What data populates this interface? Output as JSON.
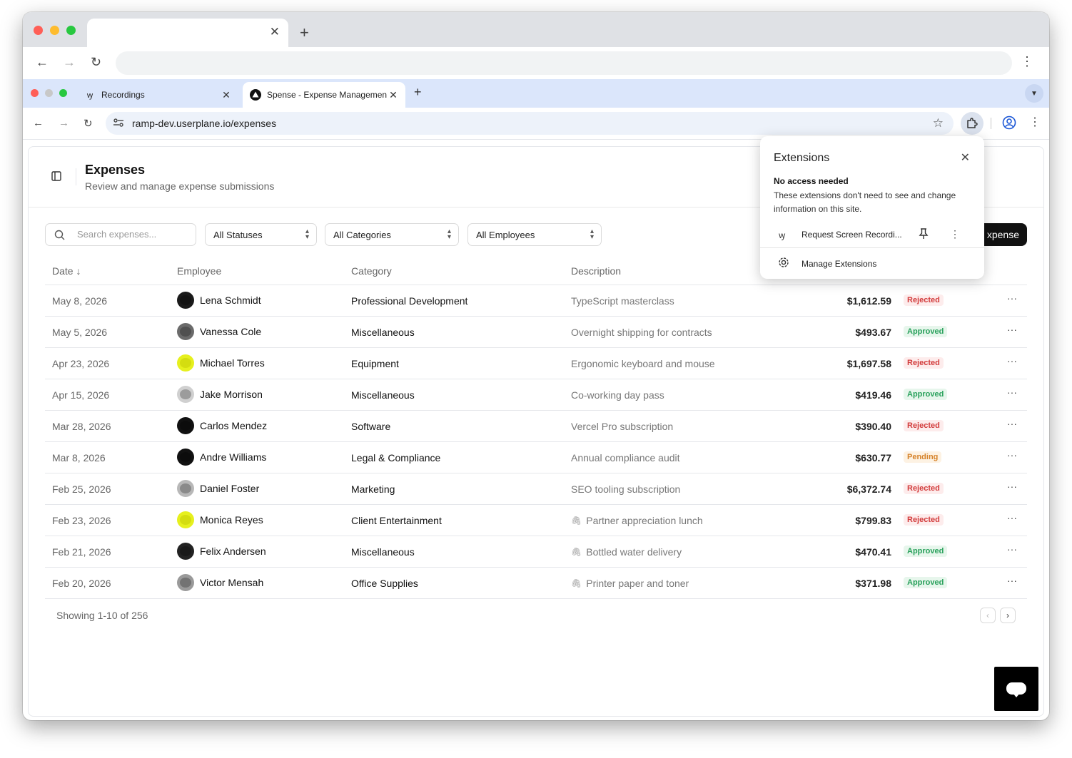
{
  "outer_browser": {
    "tab_close": "✕",
    "new_tab": "+",
    "back": "←",
    "forward": "→",
    "reload": "↻",
    "menu": "⋮"
  },
  "inner_browser": {
    "tabs": [
      {
        "title": "Recordings",
        "icon": "userplane-logo-icon",
        "favicon_glyph": "ꝡ"
      },
      {
        "title": "Spense - Expense Management",
        "icon": "spense-logo-icon"
      }
    ],
    "url": "ramp-dev.userplane.io/expenses"
  },
  "page": {
    "title": "Expenses",
    "subtitle": "Review and manage expense submissions",
    "search_placeholder": "Search expenses...",
    "filters": {
      "status": "All Statuses",
      "category": "All Categories",
      "employee": "All Employees"
    },
    "add_button": "xpense",
    "columns": {
      "date": "Date ↓",
      "employee": "Employee",
      "category": "Category",
      "description": "Description"
    },
    "rows": [
      {
        "date": "May 8, 2026",
        "employee": "Lena Schmidt",
        "category": "Professional Development",
        "description": "TypeScript masterclass",
        "amount": "$1,612.59",
        "status": "Rejected",
        "attachment": false,
        "avatar_color": "#1a1a1a"
      },
      {
        "date": "May 5, 2026",
        "employee": "Vanessa Cole",
        "category": "Miscellaneous",
        "description": "Overnight shipping for contracts",
        "amount": "$493.67",
        "status": "Approved",
        "attachment": false,
        "avatar_color": "#6b6b6b"
      },
      {
        "date": "Apr 23, 2026",
        "employee": "Michael Torres",
        "category": "Equipment",
        "description": "Ergonomic keyboard and mouse",
        "amount": "$1,697.58",
        "status": "Rejected",
        "attachment": false,
        "avatar_color": "#e6f01e"
      },
      {
        "date": "Apr 15, 2026",
        "employee": "Jake Morrison",
        "category": "Miscellaneous",
        "description": "Co-working day pass",
        "amount": "$419.46",
        "status": "Approved",
        "attachment": false,
        "avatar_color": "#d0d0d0"
      },
      {
        "date": "Mar 28, 2026",
        "employee": "Carlos Mendez",
        "category": "Software",
        "description": "Vercel Pro subscription",
        "amount": "$390.40",
        "status": "Rejected",
        "attachment": false,
        "avatar_color": "#111111"
      },
      {
        "date": "Mar 8, 2026",
        "employee": "Andre Williams",
        "category": "Legal & Compliance",
        "description": "Annual compliance audit",
        "amount": "$630.77",
        "status": "Pending",
        "attachment": false,
        "avatar_color": "#111111"
      },
      {
        "date": "Feb 25, 2026",
        "employee": "Daniel Foster",
        "category": "Marketing",
        "description": "SEO tooling subscription",
        "amount": "$6,372.74",
        "status": "Rejected",
        "attachment": false,
        "avatar_color": "#b8b8b8"
      },
      {
        "date": "Feb 23, 2026",
        "employee": "Monica Reyes",
        "category": "Client Entertainment",
        "description": "Partner appreciation lunch",
        "amount": "$799.83",
        "status": "Rejected",
        "attachment": true,
        "avatar_color": "#e6f01e"
      },
      {
        "date": "Feb 21, 2026",
        "employee": "Felix Andersen",
        "category": "Miscellaneous",
        "description": "Bottled water delivery",
        "amount": "$470.41",
        "status": "Approved",
        "attachment": true,
        "avatar_color": "#222222"
      },
      {
        "date": "Feb 20, 2026",
        "employee": "Victor Mensah",
        "category": "Office Supplies",
        "description": "Printer paper and toner",
        "amount": "$371.98",
        "status": "Approved",
        "attachment": true,
        "avatar_color": "#9a9a9a"
      }
    ],
    "more_glyph": "···",
    "pagination_text": "Showing 1-10 of 256",
    "prev": "‹",
    "next": "›"
  },
  "extensions_popup": {
    "title": "Extensions",
    "close": "✕",
    "section_heading": "No access needed",
    "section_desc": "These extensions don't need to see and change information on this site.",
    "item_name": "Request Screen Recordi...",
    "item_icon_glyph": "ꝡ",
    "item_more": "⋮",
    "manage_label": "Manage Extensions"
  },
  "colors": {
    "rejected": "#d23b3b",
    "approved": "#27a05a",
    "pending": "#d6832b",
    "inner_tabstrip": "#dbe6fb"
  }
}
